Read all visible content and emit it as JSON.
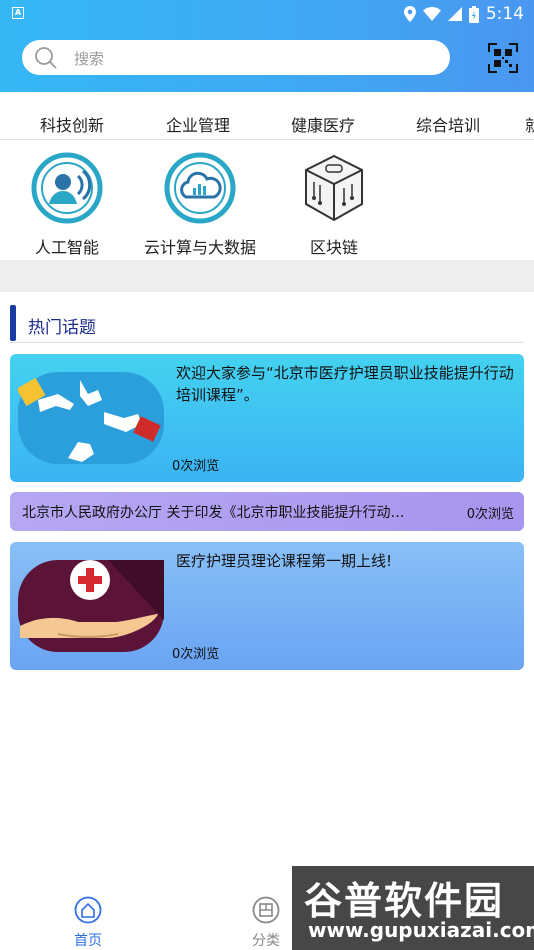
{
  "status_bar": {
    "time": "5:14",
    "left_icon_letter": "A"
  },
  "search": {
    "placeholder": "搜索"
  },
  "tabs": [
    {
      "label": "科技创新"
    },
    {
      "label": "企业管理"
    },
    {
      "label": "健康医疗"
    },
    {
      "label": "综合培训"
    },
    {
      "label": "就"
    }
  ],
  "features": [
    {
      "label": "人工智能",
      "icon": "ai-person-icon"
    },
    {
      "label": "云计算与大数据",
      "icon": "cloud-data-icon"
    },
    {
      "label": "区块链",
      "icon": "blockchain-cube-icon"
    }
  ],
  "hot_topics": {
    "title": "热门话题",
    "items": [
      {
        "title": "欢迎大家参与“北京市医疗护理员职业技能提升行动培训课程”。",
        "views": "0次浏览"
      },
      {
        "title": "北京市人民政府办公厅 关于印发《北京市职业技能提升行动…",
        "views": "0次浏览"
      },
      {
        "title": "医疗护理员理论课程第一期上线!",
        "views": "0次浏览"
      }
    ]
  },
  "bottom_nav": [
    {
      "label": "首页",
      "active": true
    },
    {
      "label": "分类",
      "active": false
    }
  ],
  "watermark": {
    "title": "谷普软件园",
    "url": "www.gupuxiazai.com"
  },
  "colors": {
    "accent": "#3aa8f3",
    "active_nav": "#2f6fe0",
    "heading": "#1b2b8e"
  }
}
